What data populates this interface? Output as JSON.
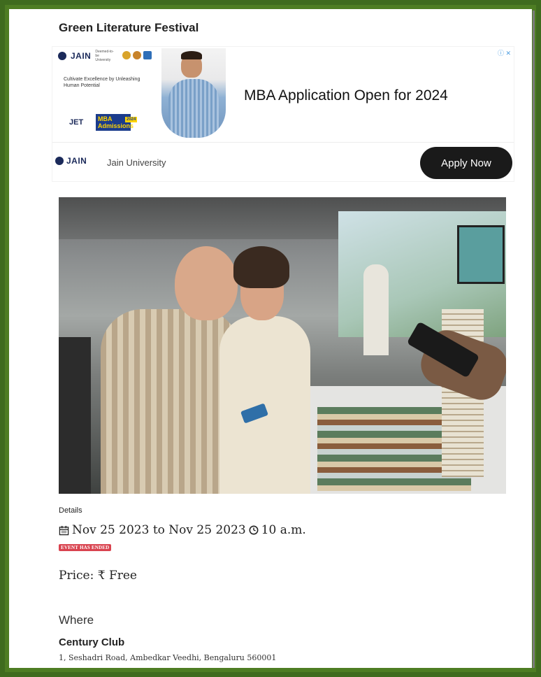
{
  "event": {
    "title": "Green Literature Festival",
    "details_label": "Details",
    "date_range": "Nov 25 2023 to Nov 25 2023",
    "time": "10 a.m.",
    "status_badge": "EVENT HAS ENDED",
    "price_label": "Price:",
    "price_currency": "₹",
    "price_value": "Free",
    "where_label": "Where",
    "venue_name": "Century Club",
    "venue_address": "1, Seshadri Road, Ambedkar Veedhi, Bengaluru 560001"
  },
  "ad": {
    "brand": "JAIN",
    "brand_sub": "Deemed-to-be University",
    "tagline": "Cultivate Excellence by Unleashing Human Potential",
    "jet_label": "JET",
    "mba_label": "MBA Admissions",
    "mba_year": "2024",
    "headline": "MBA Application Open for 2024",
    "advertiser": "Jain University",
    "cta": "Apply Now",
    "close_glyph": "ⓘ ✕"
  },
  "colors": {
    "frame_outer": "#3f6b1e",
    "frame_inner": "#4e7d23",
    "badge_red": "#d9434f",
    "cta_bg": "#1a1a1a",
    "brand_navy": "#1b2a5a"
  },
  "icons": {
    "calendar": "calendar-icon",
    "clock": "clock-icon"
  }
}
